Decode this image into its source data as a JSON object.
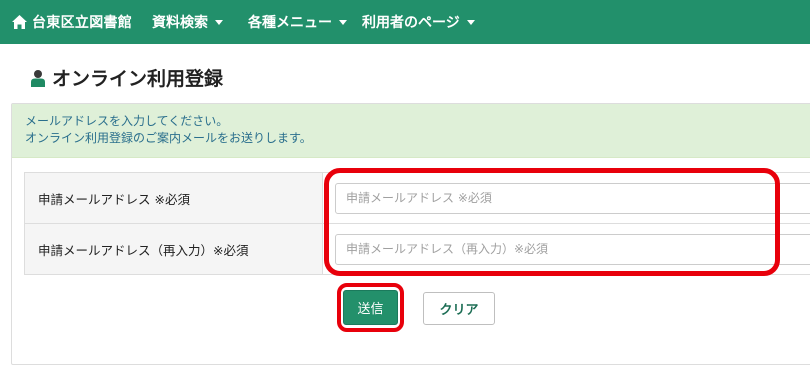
{
  "colors": {
    "nav_bg": "#22906b",
    "accent": "#23906b",
    "accent_dark": "#1d6e55",
    "info_bg": "#dff0d8",
    "info_text": "#2a6f8d",
    "highlight": "#e8000b"
  },
  "navbar": {
    "brand": "台東区立図書館",
    "brand_icon": "home-icon",
    "items": [
      {
        "label": "資料検索"
      },
      {
        "label": "各種メニュー"
      },
      {
        "label": "利用者のページ"
      }
    ]
  },
  "page": {
    "title": "オンライン利用登録",
    "title_icon": "person-icon"
  },
  "info": {
    "line1": "メールアドレスを入力してください。",
    "line2": "オンライン利用登録のご案内メールをお送りします。"
  },
  "form": {
    "email_label": "申請メールアドレス ※必須",
    "email_placeholder": "申請メールアドレス ※必須",
    "email_value": "",
    "confirm_label": "申請メールアドレス（再入力）※必須",
    "confirm_placeholder": "申請メールアドレス（再入力）※必須",
    "confirm_value": ""
  },
  "buttons": {
    "submit": "送信",
    "clear": "クリア"
  }
}
